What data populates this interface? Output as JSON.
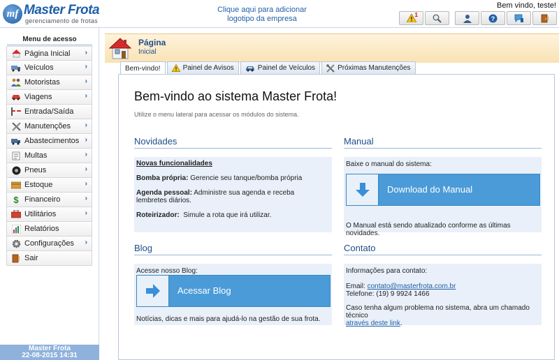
{
  "header": {
    "logo_name": "Master Frota",
    "logo_mark": "mf",
    "logo_tagline": "gerenciamento de frotas",
    "add_logo_line1": "Clique aqui para adicionar",
    "add_logo_line2": "logotipo da empresa",
    "welcome": "Bem vindo, teste!",
    "notification_count": "1",
    "toolbar_icons": [
      "warning-icon",
      "search-icon",
      "user-icon",
      "help-icon",
      "feedback-icon",
      "exit-icon"
    ]
  },
  "sidebar": {
    "title": "Menu de acesso",
    "items": [
      {
        "label": "Página Inicial",
        "icon": "home-icon",
        "arrow": "›"
      },
      {
        "label": "Veículos",
        "icon": "truck-icon",
        "arrow": "›"
      },
      {
        "label": "Motoristas",
        "icon": "drivers-icon",
        "arrow": "›"
      },
      {
        "label": "Viagens",
        "icon": "trip-icon",
        "arrow": "›"
      },
      {
        "label": "Entrada/Saída",
        "icon": "gate-icon",
        "arrow": ""
      },
      {
        "label": "Manutenções",
        "icon": "tools-icon",
        "arrow": "›"
      },
      {
        "label": "Abastecimentos",
        "icon": "fuel-icon",
        "arrow": "›"
      },
      {
        "label": "Multas",
        "icon": "fine-icon",
        "arrow": "›"
      },
      {
        "label": "Pneus",
        "icon": "tire-icon",
        "arrow": "›"
      },
      {
        "label": "Estoque",
        "icon": "stock-icon",
        "arrow": "›"
      },
      {
        "label": "Financeiro",
        "icon": "money-icon",
        "arrow": "›"
      },
      {
        "label": "Utilitários",
        "icon": "utilities-icon",
        "arrow": "›"
      },
      {
        "label": "Relatórios",
        "icon": "reports-icon",
        "arrow": ""
      },
      {
        "label": "Configurações",
        "icon": "gear-icon",
        "arrow": "›"
      },
      {
        "label": "Sair",
        "icon": "exit-icon",
        "arrow": ""
      }
    ],
    "footer_line1": "Master Frota",
    "footer_line2": "22-08-2015 14:31"
  },
  "page": {
    "title": "Página",
    "subtitle": "Inicial"
  },
  "tabs": [
    {
      "label": "Bem-vindo!",
      "icon": ""
    },
    {
      "label": "Painel de Avisos",
      "icon": "warning-icon"
    },
    {
      "label": "Painel de Veículos",
      "icon": "car-icon"
    },
    {
      "label": "Próximas Manutenções",
      "icon": "tools-icon"
    }
  ],
  "content": {
    "heading": "Bem-vindo ao sistema Master Frota!",
    "intro": "Utilize o menu lateral para acessar os módulos do sistema.",
    "novidades": {
      "title": "Novidades",
      "subtitle": "Novas funcionalidades",
      "items": [
        {
          "term": "Bomba própria:",
          "desc": "Gerencie seu tanque/bomba própria"
        },
        {
          "term": "Agenda pessoal:",
          "desc": "Administre sua agenda e receba lembretes diários."
        },
        {
          "term": "Roteirizador:",
          "desc": "Simule a rota que irá utilizar."
        }
      ]
    },
    "manual": {
      "title": "Manual",
      "lead": "Baixe o manual do sistema:",
      "button": "Download do Manual",
      "note": "O Manual está sendo atualizado conforme as últimas novidades."
    },
    "blog": {
      "title": "Blog",
      "lead": "Acesse nosso Blog:",
      "button": "Acessar Blog",
      "note": "Notícias, dicas e mais para ajudá-lo na gestão de sua frota."
    },
    "contato": {
      "title": "Contato",
      "lead": "Informações para contato:",
      "email_label": "Email:",
      "email": "contato@masterfrota.com.br",
      "phone": "Telefone: (19) 9 9924 1466",
      "note": "Caso tenha algum problema no sistema, abra um chamado técnico",
      "link": "através deste link",
      "link_end": "."
    }
  },
  "colors": {
    "brand": "#1f5fa8",
    "button": "#4a9bd8",
    "box_bg": "#e9f0f9",
    "page_head": "#f9e2b4"
  }
}
